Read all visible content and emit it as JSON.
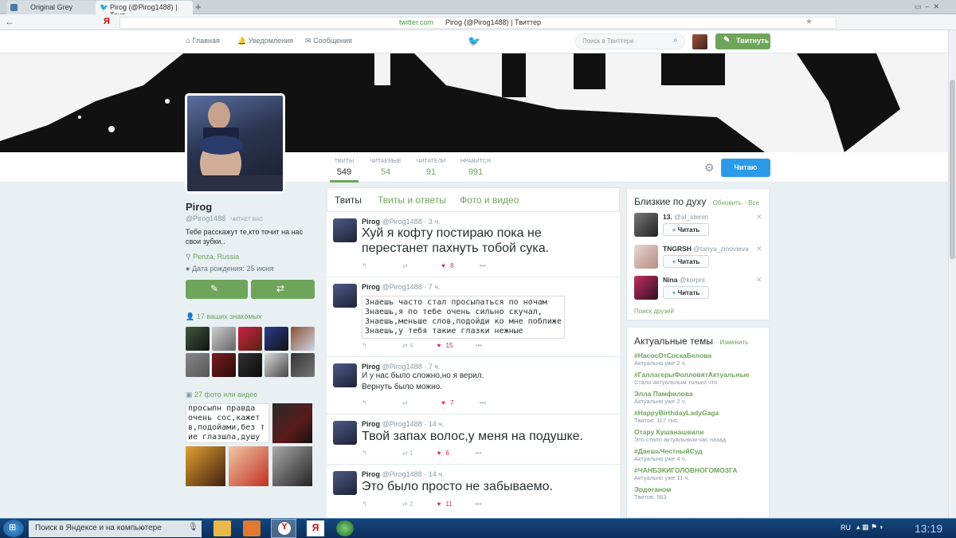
{
  "browser": {
    "tabs": [
      "Original Grey",
      "Pirog (@Pirog1488) | Твит"
    ],
    "address_domain": "twitter.com",
    "address_title": "Pirog (@Pirog1488) | Твиттер",
    "home_glyph": "Я"
  },
  "nav": {
    "home": "Главная",
    "notifications": "Уведомления",
    "messages": "Сообщения",
    "search_placeholder": "Поиск в Твиттере",
    "tweet_button": "Твитнуть"
  },
  "stats": [
    {
      "label": "ТВИТЫ",
      "value": "549"
    },
    {
      "label": "ЧИТАЕМЫЕ",
      "value": "54"
    },
    {
      "label": "ЧИТАТЕЛИ",
      "value": "91"
    },
    {
      "label": "НРАВИТСЯ",
      "value": "991"
    }
  ],
  "follow_button": "Читаю",
  "profile": {
    "name": "Pirog",
    "handle": "@Pirog1488",
    "follows_you": "ЧИТАЕТ ВАС",
    "bio": "Тебе расскажут те,кто точит на нас свои зубки..",
    "location": "Penza, Russia",
    "birthday": "Дата рождения: 25 июня",
    "mutuals": "17 ваших знакомых",
    "photos_label": "27 фото или видео",
    "photo_text": [
      "просып",
      "н правда",
      "очень с",
      "ос,кажет",
      "в,подой",
      "ами,без т",
      "ие глаз",
      "шла,душу"
    ]
  },
  "timeline_tabs": [
    "Твиты",
    "Твиты и ответы",
    "Фото и видео"
  ],
  "tweets": [
    {
      "name": "Pirog",
      "handle": "@Pirog1488",
      "time": "3 ч.",
      "text": "Хуй я кофту постираю пока не перестанет пахнуть тобой сука.",
      "retweets": "",
      "likes": "8"
    },
    {
      "name": "Pirog",
      "handle": "@Pirog1488",
      "time": "7 ч.",
      "text": "Знаешь часто стал просыпаться по ночам\nЗнаешь,я по тебе очень сильно скучал,\nЗнаешь,меньше слов,подойди ко мне поближе\nЗнаешь,у тебя такие глазки нежные",
      "retweets": "4",
      "likes": "15"
    },
    {
      "name": "Pirog",
      "handle": "@Pirog1488",
      "time": "7 ч.",
      "text": "И у нас было сложно,но я верил.\nВернуть было можно.",
      "retweets": "",
      "likes": "7"
    },
    {
      "name": "Pirog",
      "handle": "@Pirog1488",
      "time": "14 ч.",
      "text": "Твой запах волос,у меня на подушке.",
      "retweets": "1",
      "likes": "6"
    },
    {
      "name": "Pirog",
      "handle": "@Pirog1488",
      "time": "14 ч.",
      "text": "Это было просто не забываемо.",
      "retweets": "2",
      "likes": "11"
    }
  ],
  "who_to_follow": {
    "title": "Близкие по духу",
    "refresh": "Обновить",
    "all": "Все",
    "follow_label": "Читать",
    "find_friends": "Поиск друзей",
    "users": [
      {
        "name": "13.",
        "handle": "@al_stenin"
      },
      {
        "name": "TNGRSH",
        "handle": "@tanya_zinovieva"
      },
      {
        "name": "Nina",
        "handle": "@korpni"
      }
    ]
  },
  "trends": {
    "title": "Актуальные темы",
    "change": "Изменить",
    "items": [
      {
        "name": "#НасосОтСоскаБелова",
        "meta": "Актуально уже 2 ч."
      },
      {
        "name": "#ГаллагерыФолловятАктуальные",
        "meta": "Стало актуальным только что"
      },
      {
        "name": "Элла Памфилова",
        "meta": "Актуально уже 2 ч."
      },
      {
        "name": "#HappyBirthdayLadyGaga",
        "meta": "Твитов: 117 тыс."
      },
      {
        "name": "Отару Кушанашвили",
        "meta": "Это стало актуальным час назад"
      },
      {
        "name": "#ДаешьЧестныйСуд",
        "meta": "Актуально уже 4 ч."
      },
      {
        "name": "#ЧАНБЭКИГОЛОВНОГОМОЗГА",
        "meta": "Актуально уже 11 ч."
      },
      {
        "name": "Эрдоганом",
        "meta": "Твитов: 563"
      }
    ]
  },
  "taskbar": {
    "search": "Поиск в Яндексе и на компьютере",
    "lang": "RU",
    "clock": "13:19",
    "yandex_glyph": "Я"
  }
}
